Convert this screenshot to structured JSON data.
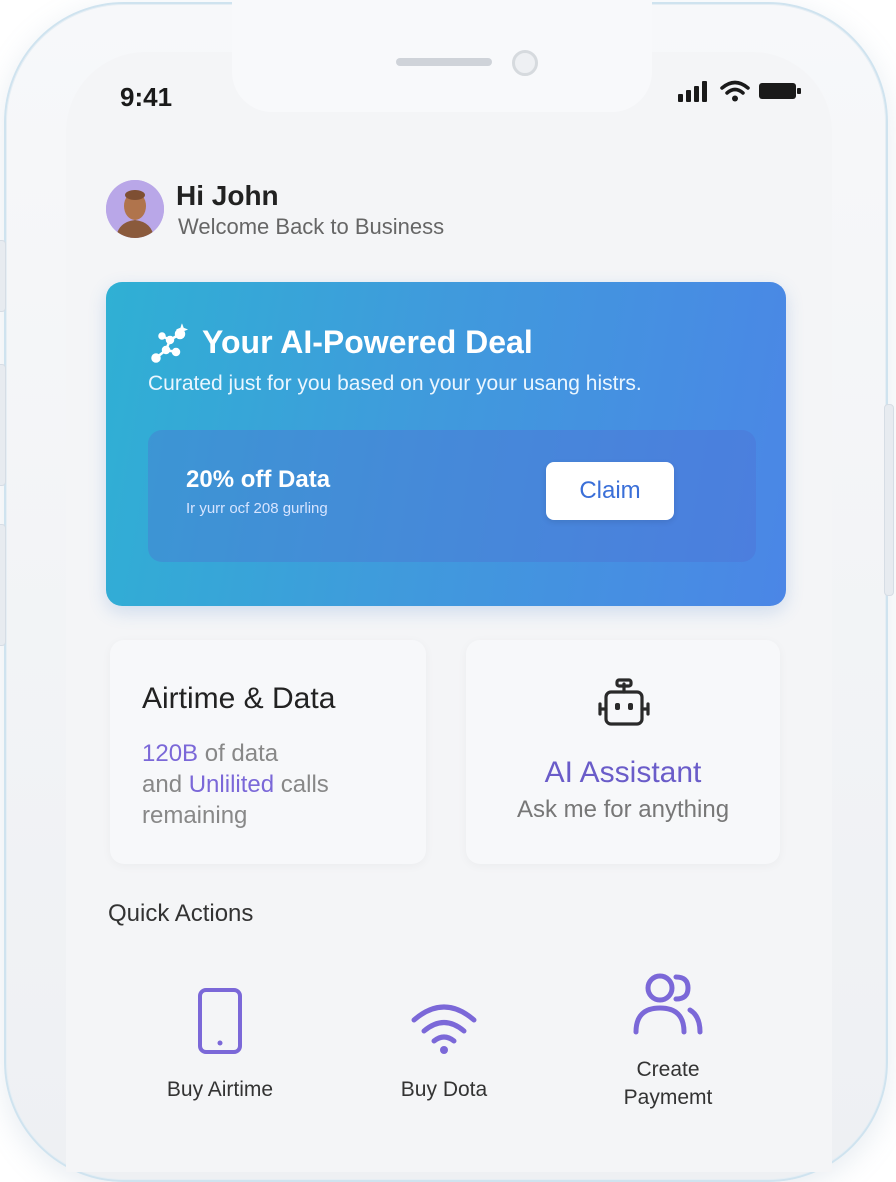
{
  "status_bar": {
    "time": "9:41",
    "icons": [
      "signal-icon",
      "wifi-icon",
      "battery-icon"
    ]
  },
  "header": {
    "greeting": "Hi John",
    "subtitle": "Welcome Back to Business"
  },
  "deal": {
    "title": "Your AI-Powered Deal",
    "subtitle": "Curated just for you based on your your usang histrs.",
    "offer_title": "20% off Data",
    "offer_sub": "Ir yurr ocf  208 gurling",
    "claim_label": "Claim",
    "icon": "sparkle-network-icon"
  },
  "airtime_card": {
    "title": "Airtime & Data",
    "data_amount": "120B",
    "text_1": " of data",
    "text_2": "and ",
    "calls": "Unlilited",
    "text_3": " calls",
    "text_4": "remaining"
  },
  "assistant_card": {
    "title": "AI Assistant",
    "subtitle": "Ask me for anything",
    "icon": "robot-icon"
  },
  "quick_actions": {
    "title": "Quick Actions",
    "items": [
      {
        "label": "Buy Airtime",
        "icon": "phone-icon"
      },
      {
        "label": "Buy Dota",
        "icon": "wifi-icon"
      },
      {
        "label": "Create Paymemt",
        "icon": "users-icon"
      }
    ]
  },
  "colors": {
    "accent": "#7b68d8",
    "deal_gradient_start": "#2fb0d4",
    "deal_gradient_end": "#4b86e6"
  }
}
